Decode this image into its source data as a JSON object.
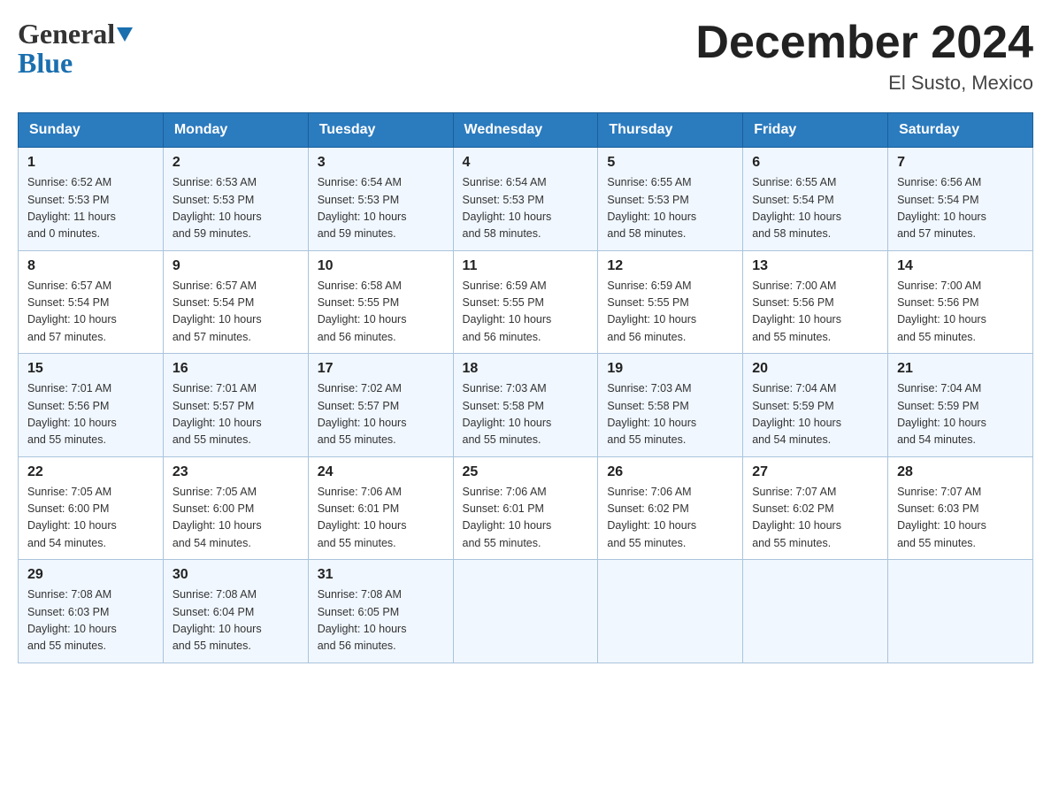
{
  "header": {
    "logo_general": "General",
    "logo_blue": "Blue",
    "month_title": "December 2024",
    "location": "El Susto, Mexico"
  },
  "weekdays": [
    "Sunday",
    "Monday",
    "Tuesday",
    "Wednesday",
    "Thursday",
    "Friday",
    "Saturday"
  ],
  "weeks": [
    [
      {
        "day": "1",
        "info": "Sunrise: 6:52 AM\nSunset: 5:53 PM\nDaylight: 11 hours\nand 0 minutes."
      },
      {
        "day": "2",
        "info": "Sunrise: 6:53 AM\nSunset: 5:53 PM\nDaylight: 10 hours\nand 59 minutes."
      },
      {
        "day": "3",
        "info": "Sunrise: 6:54 AM\nSunset: 5:53 PM\nDaylight: 10 hours\nand 59 minutes."
      },
      {
        "day": "4",
        "info": "Sunrise: 6:54 AM\nSunset: 5:53 PM\nDaylight: 10 hours\nand 58 minutes."
      },
      {
        "day": "5",
        "info": "Sunrise: 6:55 AM\nSunset: 5:53 PM\nDaylight: 10 hours\nand 58 minutes."
      },
      {
        "day": "6",
        "info": "Sunrise: 6:55 AM\nSunset: 5:54 PM\nDaylight: 10 hours\nand 58 minutes."
      },
      {
        "day": "7",
        "info": "Sunrise: 6:56 AM\nSunset: 5:54 PM\nDaylight: 10 hours\nand 57 minutes."
      }
    ],
    [
      {
        "day": "8",
        "info": "Sunrise: 6:57 AM\nSunset: 5:54 PM\nDaylight: 10 hours\nand 57 minutes."
      },
      {
        "day": "9",
        "info": "Sunrise: 6:57 AM\nSunset: 5:54 PM\nDaylight: 10 hours\nand 57 minutes."
      },
      {
        "day": "10",
        "info": "Sunrise: 6:58 AM\nSunset: 5:55 PM\nDaylight: 10 hours\nand 56 minutes."
      },
      {
        "day": "11",
        "info": "Sunrise: 6:59 AM\nSunset: 5:55 PM\nDaylight: 10 hours\nand 56 minutes."
      },
      {
        "day": "12",
        "info": "Sunrise: 6:59 AM\nSunset: 5:55 PM\nDaylight: 10 hours\nand 56 minutes."
      },
      {
        "day": "13",
        "info": "Sunrise: 7:00 AM\nSunset: 5:56 PM\nDaylight: 10 hours\nand 55 minutes."
      },
      {
        "day": "14",
        "info": "Sunrise: 7:00 AM\nSunset: 5:56 PM\nDaylight: 10 hours\nand 55 minutes."
      }
    ],
    [
      {
        "day": "15",
        "info": "Sunrise: 7:01 AM\nSunset: 5:56 PM\nDaylight: 10 hours\nand 55 minutes."
      },
      {
        "day": "16",
        "info": "Sunrise: 7:01 AM\nSunset: 5:57 PM\nDaylight: 10 hours\nand 55 minutes."
      },
      {
        "day": "17",
        "info": "Sunrise: 7:02 AM\nSunset: 5:57 PM\nDaylight: 10 hours\nand 55 minutes."
      },
      {
        "day": "18",
        "info": "Sunrise: 7:03 AM\nSunset: 5:58 PM\nDaylight: 10 hours\nand 55 minutes."
      },
      {
        "day": "19",
        "info": "Sunrise: 7:03 AM\nSunset: 5:58 PM\nDaylight: 10 hours\nand 55 minutes."
      },
      {
        "day": "20",
        "info": "Sunrise: 7:04 AM\nSunset: 5:59 PM\nDaylight: 10 hours\nand 54 minutes."
      },
      {
        "day": "21",
        "info": "Sunrise: 7:04 AM\nSunset: 5:59 PM\nDaylight: 10 hours\nand 54 minutes."
      }
    ],
    [
      {
        "day": "22",
        "info": "Sunrise: 7:05 AM\nSunset: 6:00 PM\nDaylight: 10 hours\nand 54 minutes."
      },
      {
        "day": "23",
        "info": "Sunrise: 7:05 AM\nSunset: 6:00 PM\nDaylight: 10 hours\nand 54 minutes."
      },
      {
        "day": "24",
        "info": "Sunrise: 7:06 AM\nSunset: 6:01 PM\nDaylight: 10 hours\nand 55 minutes."
      },
      {
        "day": "25",
        "info": "Sunrise: 7:06 AM\nSunset: 6:01 PM\nDaylight: 10 hours\nand 55 minutes."
      },
      {
        "day": "26",
        "info": "Sunrise: 7:06 AM\nSunset: 6:02 PM\nDaylight: 10 hours\nand 55 minutes."
      },
      {
        "day": "27",
        "info": "Sunrise: 7:07 AM\nSunset: 6:02 PM\nDaylight: 10 hours\nand 55 minutes."
      },
      {
        "day": "28",
        "info": "Sunrise: 7:07 AM\nSunset: 6:03 PM\nDaylight: 10 hours\nand 55 minutes."
      }
    ],
    [
      {
        "day": "29",
        "info": "Sunrise: 7:08 AM\nSunset: 6:03 PM\nDaylight: 10 hours\nand 55 minutes."
      },
      {
        "day": "30",
        "info": "Sunrise: 7:08 AM\nSunset: 6:04 PM\nDaylight: 10 hours\nand 55 minutes."
      },
      {
        "day": "31",
        "info": "Sunrise: 7:08 AM\nSunset: 6:05 PM\nDaylight: 10 hours\nand 56 minutes."
      },
      {
        "day": "",
        "info": ""
      },
      {
        "day": "",
        "info": ""
      },
      {
        "day": "",
        "info": ""
      },
      {
        "day": "",
        "info": ""
      }
    ]
  ]
}
